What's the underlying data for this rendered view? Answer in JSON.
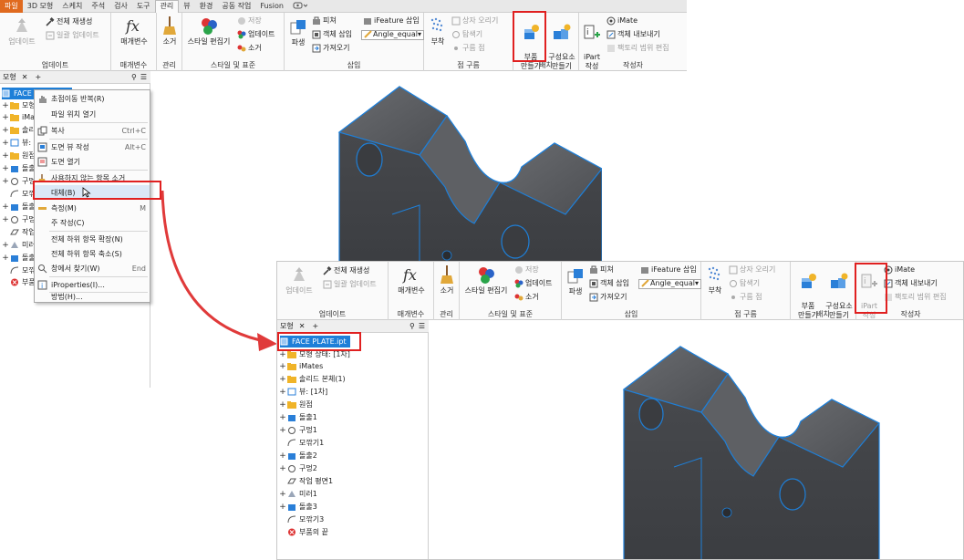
{
  "top": {
    "tabs": [
      "파일",
      "3D 모형",
      "스케치",
      "주석",
      "검사",
      "도구",
      "관리",
      "뷰",
      "환경",
      "공동 작업",
      "Fusion"
    ],
    "active_tab": "관리",
    "groups": {
      "update": {
        "label": "업데이트",
        "btn_update": "업데이트",
        "btn_rebuild_all": "전체 재생성",
        "btn_lazy_update": "일괄 업데이트"
      },
      "params": {
        "label": "매개변수",
        "btn_params": "매개변수"
      },
      "manage": {
        "label": "관리",
        "btn_purge": "소거"
      },
      "styles": {
        "label": "스타일 및 표준",
        "btn_style_editor": "스타일 편집기",
        "btn_save": "저장",
        "btn_update": "업데이트",
        "btn_purge": "소거"
      },
      "insert": {
        "label": "삽입",
        "btn_derive": "파생",
        "btn_attach": "피쳐",
        "btn_object_insert": "객체 삽입",
        "btn_import": "가져오기",
        "btn_ifeature": "iFeature 삽입",
        "dropdown_value": "Angle_equal"
      },
      "point_cloud": {
        "label": "점 구름",
        "btn_attach": "부착",
        "btn_box_crop": "상자 오리기",
        "btn_explore": "탐색기",
        "btn_cloud_point": "구름 점"
      },
      "layout": {
        "label": "배치",
        "btn_make_part": "부품\n만들기",
        "btn_make_components": "구성요소\n만들기"
      },
      "author": {
        "label": "작성자",
        "btn_ipart": "iPart\n작성",
        "btn_imate": "iMate",
        "btn_export_object": "객체 내보내기",
        "btn_factory_scope": "팩토리 범위 편집"
      }
    },
    "browser": {
      "tab_label": "모형",
      "items": [
        "FACE PLATE.ipt",
        "모형",
        "iMate",
        "솔리",
        "뷰:",
        "원점",
        "돌출",
        "구멍",
        "모깎",
        "돌출",
        "구멍",
        "작업",
        "미러",
        "돌출",
        "모깎",
        "부품"
      ]
    },
    "context_menu": {
      "items": [
        {
          "label": "초점이동 반복(R)",
          "shortcut": ""
        },
        {
          "label": "파일 위치 열기",
          "shortcut": ""
        },
        {
          "label": "복사",
          "shortcut": "Ctrl+C"
        },
        {
          "label": "도면 뷰 작성",
          "shortcut": "Alt+C"
        },
        {
          "label": "도면 열기",
          "shortcut": ""
        },
        {
          "label": "사용하지 않는 항목 소거",
          "shortcut": ""
        },
        {
          "label": "대체(B)",
          "shortcut": ""
        },
        {
          "label": "측정(M)",
          "shortcut": "M"
        },
        {
          "label": "주 작성(C)",
          "shortcut": ""
        },
        {
          "label": "전체 하위 항목 확장(N)",
          "shortcut": ""
        },
        {
          "label": "전체 하위 항목 축소(S)",
          "shortcut": ""
        },
        {
          "label": "창에서 찾기(W)",
          "shortcut": "End"
        },
        {
          "label": "iProperties(I)...",
          "shortcut": ""
        },
        {
          "label": "방법(H)...",
          "shortcut": ""
        }
      ]
    }
  },
  "bottom": {
    "groups": {
      "update": {
        "label": "업데이트",
        "btn_update": "업데이트",
        "btn_rebuild_all": "전체 재생성",
        "btn_lazy_update": "일괄 업데이트"
      },
      "params": {
        "label": "매개변수",
        "btn_params": "매개변수"
      },
      "manage": {
        "label": "관리",
        "btn_purge": "소거"
      },
      "styles": {
        "label": "스타일 및 표준",
        "btn_style_editor": "스타일 편집기",
        "btn_save": "저장",
        "btn_update": "업데이트",
        "btn_purge": "소거"
      },
      "insert": {
        "label": "삽입",
        "btn_derive": "파생",
        "btn_attach": "피쳐",
        "btn_object_insert": "객체 삽입",
        "btn_import": "가져오기",
        "btn_ifeature": "iFeature 삽입",
        "dropdown_value": "Angle_equal"
      },
      "point_cloud": {
        "label": "점 구름",
        "btn_attach": "부착",
        "btn_box_crop": "상자 오리기",
        "btn_explore": "탐색기",
        "btn_cloud_point": "구름 점"
      },
      "layout": {
        "label": "배치",
        "btn_make_part": "부품\n만들기",
        "btn_make_components": "구성요소\n만들기"
      },
      "author": {
        "label": "작성자",
        "btn_ipart": "iPart\n작성",
        "btn_imate": "iMate",
        "btn_export_object": "객체 내보내기",
        "btn_factory_scope": "팩토리 범위 편집"
      }
    },
    "browser": {
      "tab_label": "모형",
      "items": [
        "FACE PLATE.ipt",
        "모형 상태: [1차]",
        "iMates",
        "솔리드 본체(1)",
        "뷰: [1차]",
        "원점",
        "돌출1",
        "구멍1",
        "모깎기1",
        "돌출2",
        "구멍2",
        "작업 평면1",
        "미러1",
        "돌출3",
        "모깎기3",
        "부품의 끝"
      ]
    }
  },
  "colors": {
    "accent_red": "#e02020",
    "file_tab": "#e06a1f",
    "highlight_blue": "#1e7fd8",
    "model_dark": "#55575c"
  }
}
